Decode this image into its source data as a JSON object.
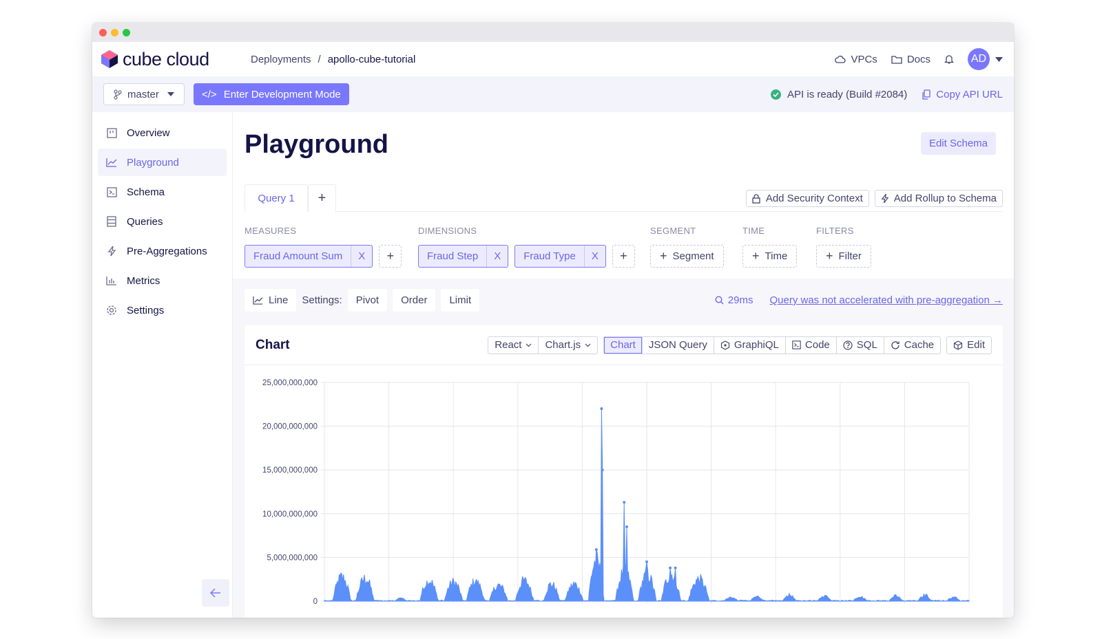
{
  "app": {
    "logo_text": "cube cloud",
    "brand_color": "#7a77ff"
  },
  "breadcrumb": {
    "parent": "Deployments",
    "separator": "/",
    "current": "apollo-cube-tutorial"
  },
  "topnav": {
    "vpcs": "VPCs",
    "docs": "Docs",
    "avatar_initials": "AD"
  },
  "toolbar": {
    "branch": "master",
    "dev_mode_label": "Enter Development Mode",
    "dev_mode_icon": "</>",
    "status_text": "API is ready (Build #2084)",
    "copy_api_url": "Copy API URL"
  },
  "sidebar": {
    "items": [
      {
        "label": "Overview",
        "icon": "overview-icon"
      },
      {
        "label": "Playground",
        "icon": "chart-line-icon",
        "active": true
      },
      {
        "label": "Schema",
        "icon": "terminal-icon"
      },
      {
        "label": "Queries",
        "icon": "list-icon"
      },
      {
        "label": "Pre-Aggregations",
        "icon": "bolt-icon"
      },
      {
        "label": "Metrics",
        "icon": "bar-chart-icon"
      },
      {
        "label": "Settings",
        "icon": "gear-icon"
      }
    ]
  },
  "page": {
    "title": "Playground",
    "edit_schema": "Edit Schema"
  },
  "query_tabs": {
    "tabs": [
      "Query 1"
    ],
    "add": "+",
    "add_security_context": "Add Security Context",
    "add_rollup": "Add Rollup to Schema"
  },
  "builder": {
    "measures_label": "MEASURES",
    "measures": [
      "Fraud Amount Sum"
    ],
    "dimensions_label": "DIMENSIONS",
    "dimensions": [
      "Fraud Step",
      "Fraud Type"
    ],
    "segment_label": "SEGMENT",
    "segment_button": "Segment",
    "time_label": "TIME",
    "time_button": "Time",
    "filters_label": "FILTERS",
    "filter_button": "Filter",
    "remove_glyph": "X",
    "plus_glyph": "+"
  },
  "settings_bar": {
    "chart_type": "Line",
    "settings_label": "Settings:",
    "pivot": "Pivot",
    "order": "Order",
    "limit": "Limit",
    "timing": "29ms",
    "accel_link": "Query was not accelerated with pre-aggregation →"
  },
  "chart_card": {
    "title": "Chart",
    "framework": "React",
    "library": "Chart.js",
    "views": [
      "Chart",
      "JSON Query",
      "GraphiQL",
      "Code",
      "SQL",
      "Cache"
    ],
    "active_view": "Chart",
    "edit": "Edit"
  },
  "chart_data": {
    "type": "area",
    "color": "#5b8ff9",
    "ylim": [
      0,
      25000000000
    ],
    "yticks": [
      "0",
      "5,000,000,000",
      "10,000,000,000",
      "15,000,000,000",
      "20,000,000,000",
      "25,000,000,000"
    ],
    "x_gridlines": 11,
    "points_count": 743,
    "peaks": [
      {
        "x": 0.429,
        "value": 22000000000
      },
      {
        "x": 0.431,
        "value": 15000000000
      },
      {
        "x": 0.465,
        "value": 11300000000
      },
      {
        "x": 0.468,
        "value": 8500000000
      },
      {
        "x": 0.421,
        "value": 5900000000
      },
      {
        "x": 0.499,
        "value": 4500000000
      },
      {
        "x": 0.535,
        "value": 3800000000
      },
      {
        "x": 0.544,
        "value": 3800000000
      }
    ]
  }
}
